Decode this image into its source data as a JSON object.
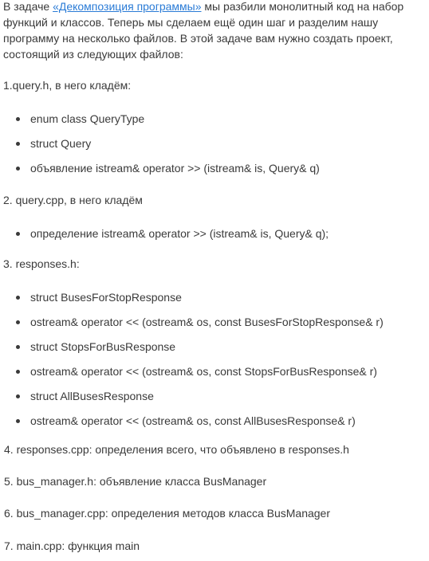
{
  "intro": {
    "prefix": "В задаче ",
    "link_text": "«Декомпозиция программы»",
    "suffix": " мы разбили монолитный код на набор функций и классов. Теперь мы сделаем ещё один шаг и разделим нашу программу на несколько файлов. В этой задаче вам нужно создать проект, состоящий из следующих файлов:"
  },
  "items": [
    {
      "title": "1.query.h, в него кладём:",
      "bullets": [
        "enum class QueryType",
        "struct Query",
        "объявление istream& operator >> (istream& is, Query& q)"
      ]
    },
    {
      "title": "2. query.cpp, в него кладём",
      "bullets": [
        "определение istream& operator >> (istream& is, Query& q);"
      ]
    },
    {
      "title": "3. responses.h:",
      "bullets": [
        "struct BusesForStopResponse",
        "ostream& operator << (ostream& os, const BusesForStopResponse& r)",
        "struct StopsForBusResponse",
        "ostream& operator << (ostream& os, const StopsForBusResponse& r)",
        "struct AllBusesResponse",
        "ostream& operator << (ostream& os, const AllBusesResponse& r)"
      ]
    },
    {
      "title": "4. responses.cpp: определения всего, что объявлено в responses.h"
    },
    {
      "title": "5. bus_manager.h: объявление класса BusManager"
    },
    {
      "title": "6. bus_manager.cpp: определения методов класса BusManager"
    },
    {
      "title": "7. main.cpp: функция main"
    }
  ]
}
